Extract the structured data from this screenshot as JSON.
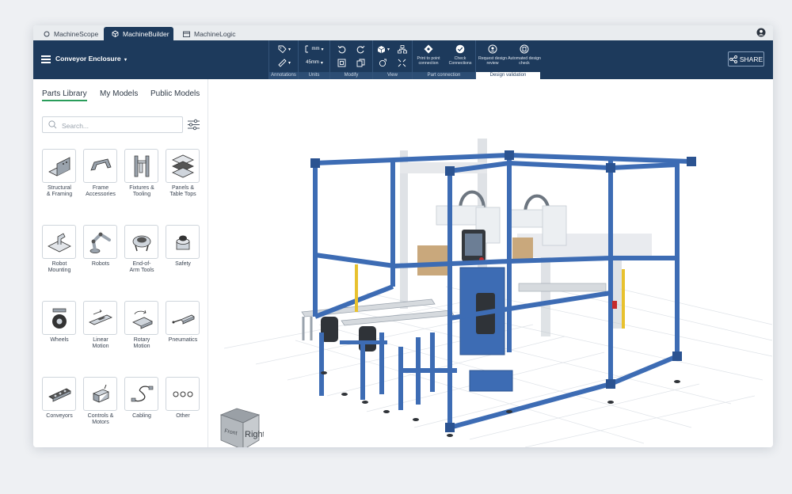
{
  "app_tabs": [
    {
      "label": "MachineScope",
      "icon": "circle-icon"
    },
    {
      "label": "MachineBuilder",
      "icon": "cube-icon"
    },
    {
      "label": "MachineLogic",
      "icon": "calendar-icon"
    }
  ],
  "project": {
    "title": "Conveyor Enclosure"
  },
  "toolbar": {
    "groups": [
      "Annotations",
      "Units",
      "Modify",
      "View",
      "Part connection",
      "Design validation"
    ],
    "units": {
      "length": "mm",
      "angle": "45mm"
    },
    "buttons": {
      "print_connection": "Print to point connection",
      "check_connections": "Check Connections",
      "request_review": "Request design review",
      "automated_check": "Automated design check"
    },
    "share_label": "SHARE"
  },
  "library": {
    "tabs": [
      "Parts Library",
      "My Models",
      "Public Models"
    ],
    "search_placeholder": "Search...",
    "categories": [
      {
        "label": "Structural\n& Framing",
        "icon": "structural-framing-icon"
      },
      {
        "label": "Frame\nAccessories",
        "icon": "frame-accessories-icon"
      },
      {
        "label": "Fixtures &\nTooling",
        "icon": "fixtures-tooling-icon"
      },
      {
        "label": "Panels &\nTable Tops",
        "icon": "panels-icon"
      },
      {
        "label": "Robot\nMounting",
        "icon": "robot-mounting-icon"
      },
      {
        "label": "Robots",
        "icon": "robot-arm-icon"
      },
      {
        "label": "End-of-\nArm Tools",
        "icon": "gripper-icon"
      },
      {
        "label": "Safety",
        "icon": "safety-button-icon"
      },
      {
        "label": "Wheels",
        "icon": "wheel-icon"
      },
      {
        "label": "Linear\nMotion",
        "icon": "linear-motion-icon"
      },
      {
        "label": "Rotary\nMotion",
        "icon": "rotary-motion-icon"
      },
      {
        "label": "Pneumatics",
        "icon": "pneumatic-cylinder-icon"
      },
      {
        "label": "Conveyors",
        "icon": "conveyor-icon"
      },
      {
        "label": "Controls &\nMotors",
        "icon": "motor-icon"
      },
      {
        "label": "Cabling",
        "icon": "cable-icon"
      },
      {
        "label": "Other",
        "icon": "ellipsis-icon"
      }
    ]
  },
  "viewcube": {
    "front": "Front",
    "right": "Right"
  },
  "colors": {
    "header": "#1d3a5c",
    "frame_blue": "#3d6cb4",
    "accent_green": "#2a9d5b"
  }
}
